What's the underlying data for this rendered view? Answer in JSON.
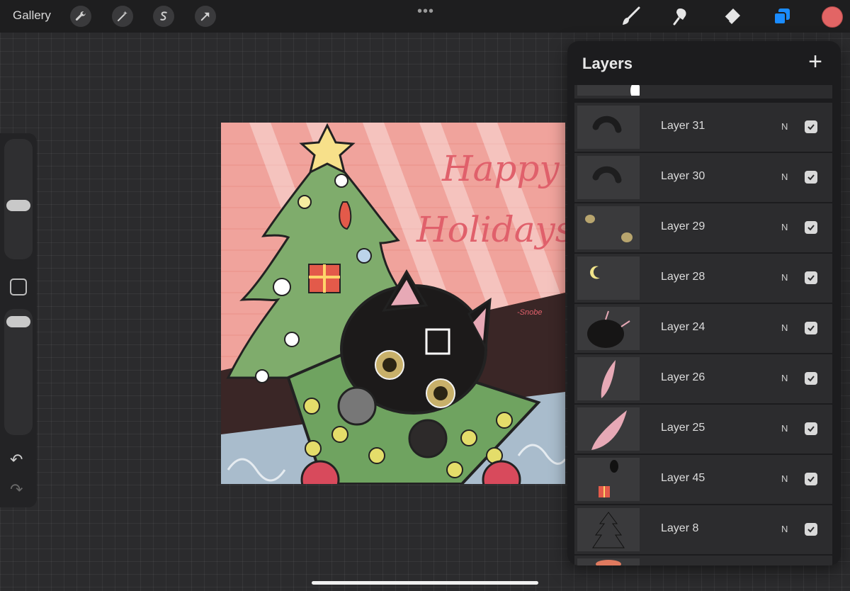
{
  "toolbar": {
    "gallery_label": "Gallery",
    "left_tools": [
      "wrench-icon",
      "magic-wand-icon",
      "selection-icon",
      "transform-icon"
    ],
    "right_tools": [
      "brush-icon",
      "smudge-icon",
      "eraser-icon",
      "layers-icon"
    ],
    "active_tool": "layers-icon",
    "current_color": "#e26565",
    "accent_color": "#1a8cff"
  },
  "canvas": {
    "greeting_line_1": "Happy",
    "greeting_line_2": "Holidays",
    "signature": "-Snobe"
  },
  "layers": {
    "title": "Layers",
    "add_label": "+",
    "items": [
      {
        "name": "Layer 31",
        "mode": "N",
        "visible": true
      },
      {
        "name": "Layer 30",
        "mode": "N",
        "visible": true
      },
      {
        "name": "Layer 29",
        "mode": "N",
        "visible": true
      },
      {
        "name": "Layer 28",
        "mode": "N",
        "visible": true
      },
      {
        "name": "Layer 24",
        "mode": "N",
        "visible": true
      },
      {
        "name": "Layer 26",
        "mode": "N",
        "visible": true
      },
      {
        "name": "Layer 25",
        "mode": "N",
        "visible": true
      },
      {
        "name": "Layer 45",
        "mode": "N",
        "visible": true
      },
      {
        "name": "Layer 8",
        "mode": "N",
        "visible": true
      }
    ]
  }
}
